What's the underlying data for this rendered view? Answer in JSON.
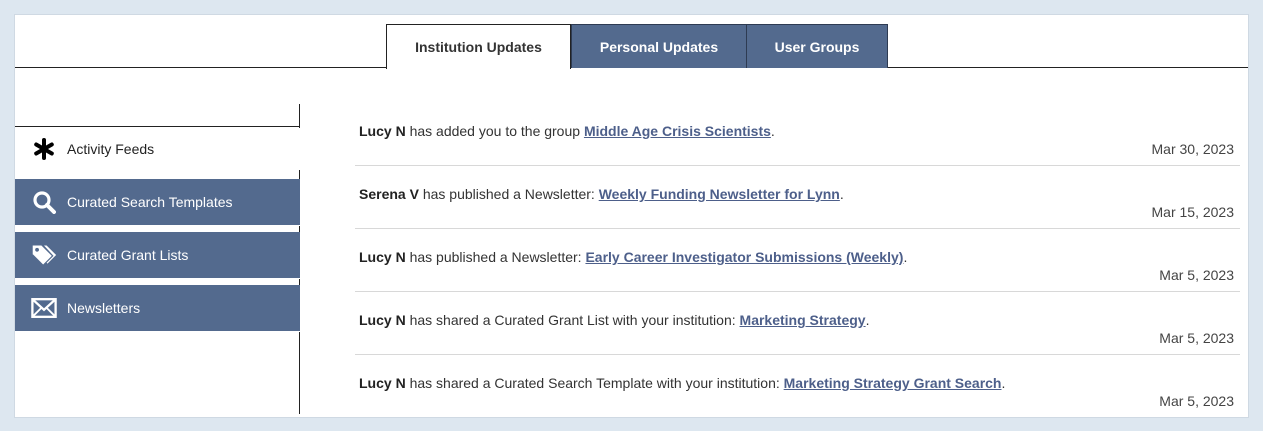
{
  "tabs": [
    {
      "label": "Institution Updates",
      "active": true
    },
    {
      "label": "Personal Updates",
      "active": false
    },
    {
      "label": "User Groups",
      "active": false
    }
  ],
  "sidebar": {
    "items": [
      {
        "label": "Activity Feeds",
        "icon": "asterisk-icon",
        "active": true
      },
      {
        "label": "Curated Search Templates",
        "icon": "search-icon",
        "active": false
      },
      {
        "label": "Curated Grant Lists",
        "icon": "tags-icon",
        "active": false
      },
      {
        "label": "Newsletters",
        "icon": "envelope-icon",
        "active": false
      }
    ]
  },
  "feed": [
    {
      "user": "Lucy N",
      "action": " has added you to the group ",
      "link": "Middle Age Crisis Scientists",
      "suffix": ".",
      "date": "Mar 30, 2023"
    },
    {
      "user": "Serena V",
      "action": " has published a Newsletter: ",
      "link": "Weekly Funding Newsletter for Lynn",
      "suffix": ".",
      "date": "Mar 15, 2023"
    },
    {
      "user": "Lucy N",
      "action": " has published a Newsletter: ",
      "link": "Early Career Investigator Submissions (Weekly)",
      "suffix": ".",
      "date": "Mar 5, 2023"
    },
    {
      "user": "Lucy N",
      "action": " has shared a Curated Grant List with your institution: ",
      "link": "Marketing Strategy",
      "suffix": ".",
      "date": "Mar 5, 2023"
    },
    {
      "user": "Lucy N",
      "action": " has shared a Curated Search Template with your institution: ",
      "link": "Marketing Strategy Grant Search",
      "suffix": ".",
      "date": "Mar 5, 2023"
    }
  ],
  "colors": {
    "nav_bg": "#536a8e",
    "link": "#4d5f8a",
    "page_bg": "#dde7f0"
  }
}
